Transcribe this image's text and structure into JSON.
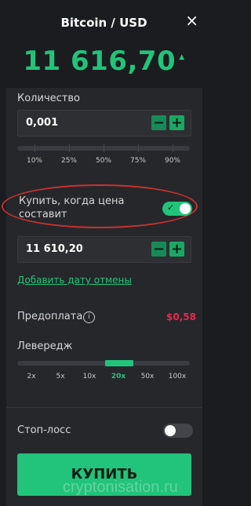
{
  "header": {
    "title": "Bitcoin / USD",
    "close_icon": "×",
    "price": "11 616,70",
    "price_trend_icon": "▲"
  },
  "quantity": {
    "label": "Количество",
    "value": "0,001",
    "minus": "−",
    "plus": "+",
    "percent_marks": [
      "10%",
      "25%",
      "50%",
      "75%",
      "90%"
    ]
  },
  "limit": {
    "label_line1": "Купить, когда цена",
    "label_line2": "составит",
    "toggle_on": true,
    "value": "11 610,20",
    "minus": "−",
    "plus": "+",
    "add_cancel_date": "Добавить дату отмены"
  },
  "prepayment": {
    "label": "Предоплата",
    "info_icon": "i",
    "value": "$0,58"
  },
  "leverage": {
    "label": "Левередж",
    "options": [
      "2x",
      "5x",
      "10x",
      "20x",
      "50x",
      "100x"
    ],
    "selected_index": 3
  },
  "stop_loss": {
    "label": "Стоп-лосс",
    "toggle_on": false
  },
  "buy_button": {
    "label": "КУПИТЬ"
  },
  "watermark": {
    "text": "cryptonisation.ru"
  },
  "colors": {
    "accent": "#21c47a",
    "danger": "#e8294f",
    "highlight": "#c8322f"
  }
}
